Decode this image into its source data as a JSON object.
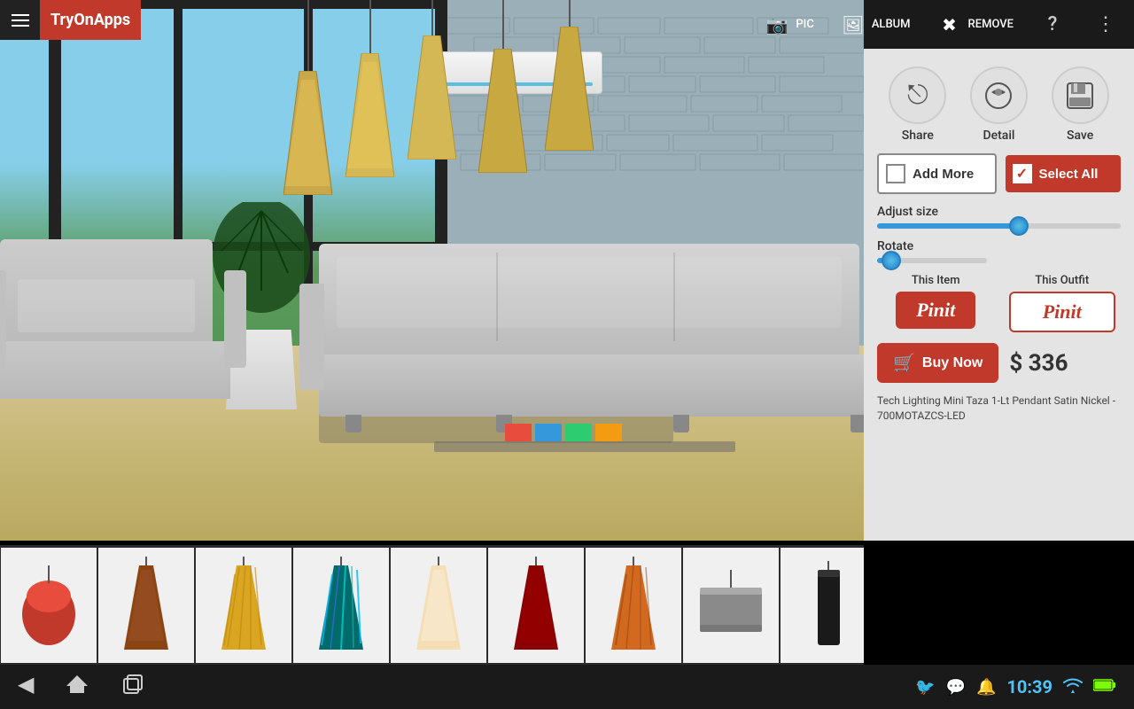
{
  "app": {
    "name": "TryOnApps"
  },
  "toolbar": {
    "pic_label": "PIC",
    "album_label": "ALBUM",
    "remove_label": "REMOVE"
  },
  "right_panel": {
    "share_label": "Share",
    "detail_label": "Detail",
    "save_label": "Save",
    "add_more_label": "Add More",
    "select_all_label": "Select All",
    "adjust_size_label": "Adjust size",
    "rotate_label": "Rotate",
    "this_item_label": "This Item",
    "this_outfit_label": "This Outfit",
    "pinit_label": "Pinit",
    "buy_now_label": "Buy Now",
    "price": "$ 336",
    "product_name": "Tech Lighting Mini Taza 1-Lt Pendant Satin Nickel - 700MOTAZCS-LED"
  },
  "bottom_nav": {
    "time": "10:39"
  },
  "thumbnails": [
    {
      "id": 1,
      "color": "#c0392b",
      "type": "round"
    },
    {
      "id": 2,
      "color": "#8B4513",
      "type": "tall"
    },
    {
      "id": 3,
      "color": "#DAA520",
      "type": "tall"
    },
    {
      "id": 4,
      "color": "#008B8B",
      "type": "tall"
    },
    {
      "id": 5,
      "color": "#F5DEB3",
      "type": "tall"
    },
    {
      "id": 6,
      "color": "#8B0000",
      "type": "tall"
    },
    {
      "id": 7,
      "color": "#D2691E",
      "type": "tall"
    },
    {
      "id": 8,
      "color": "#696969",
      "type": "drum"
    },
    {
      "id": 9,
      "color": "#333333",
      "type": "cylinder"
    }
  ]
}
